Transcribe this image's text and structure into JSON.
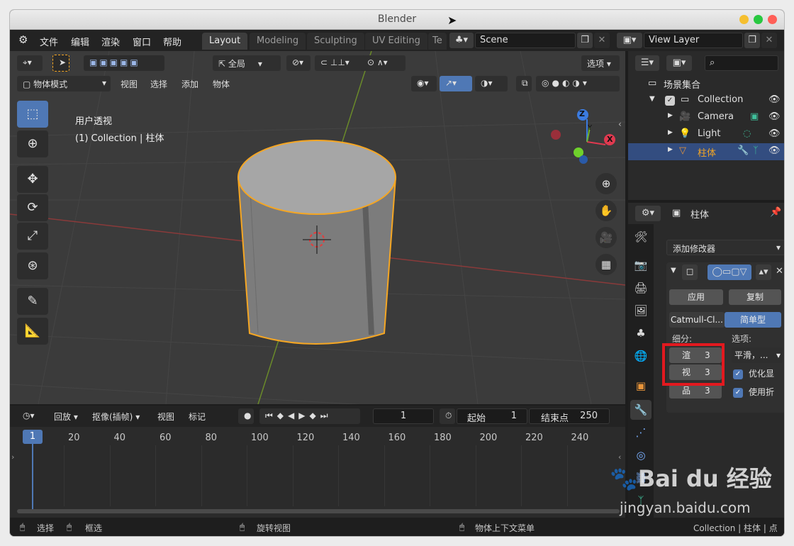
{
  "window": {
    "title": "Blender"
  },
  "menu": {
    "file": "文件",
    "edit": "编辑",
    "render": "渲染",
    "window": "窗口",
    "help": "帮助"
  },
  "workspaces": [
    {
      "label": "Layout",
      "active": true
    },
    {
      "label": "Modeling",
      "active": false
    },
    {
      "label": "Sculpting",
      "active": false
    },
    {
      "label": "UV Editing",
      "active": false
    },
    {
      "label": "Te",
      "active": false
    }
  ],
  "scene": {
    "name": "Scene"
  },
  "view_layer": {
    "name": "View Layer"
  },
  "viewport": {
    "orientation": "全局",
    "options_label": "选项",
    "mode": "物体模式",
    "menus": {
      "view": "视图",
      "select": "选择",
      "add": "添加",
      "object": "物体"
    },
    "overlay_title": "用户透视",
    "overlay_subtitle": "(1) Collection | 柱体",
    "gizmo": {
      "z": "Z",
      "y": "Y",
      "x": "X"
    }
  },
  "outliner": {
    "root": "场景集合",
    "collection": "Collection",
    "items": [
      {
        "label": "Camera"
      },
      {
        "label": "Light"
      },
      {
        "label": "柱体"
      }
    ]
  },
  "properties": {
    "object_name": "柱体",
    "add_modifier": "添加修改器",
    "apply": "应用",
    "copy": "复制",
    "catmull": "Catmull-Cl...",
    "simple": "简单型",
    "subdiv_label": "细分:",
    "options_label": "选项:",
    "render_label": "渲",
    "render_value": "3",
    "viewport_label": "视",
    "viewport_value": "3",
    "quality_label": "品",
    "quality_value": "3",
    "smooth_dropdown": "平滑，...",
    "optimal_display": "优化显",
    "use_crease": "使用折"
  },
  "timeline": {
    "playback": "回放",
    "keying": "抠像(插帧)",
    "view": "视图",
    "marker": "标记",
    "current_frame": "1",
    "start_label": "起始",
    "start_value": "1",
    "end_label": "结束点",
    "end_value": "250",
    "frame_marker": "1",
    "ticks": [
      "20",
      "40",
      "60",
      "80",
      "100",
      "120",
      "140",
      "160",
      "180",
      "200",
      "220",
      "240"
    ]
  },
  "statusbar": {
    "select": "选择",
    "box_select": "框选",
    "rotate_view": "旋转视图",
    "context_menu": "物体上下文菜单",
    "info": "Collection | 柱体 | 点"
  },
  "watermark": {
    "brand": "Bai du 经验",
    "url": "jingyan.baidu.com"
  },
  "colors": {
    "accent": "#4f78b5",
    "selection": "#334d80",
    "highlight_box": "#e2191f",
    "object_outline": "#f5a623"
  }
}
